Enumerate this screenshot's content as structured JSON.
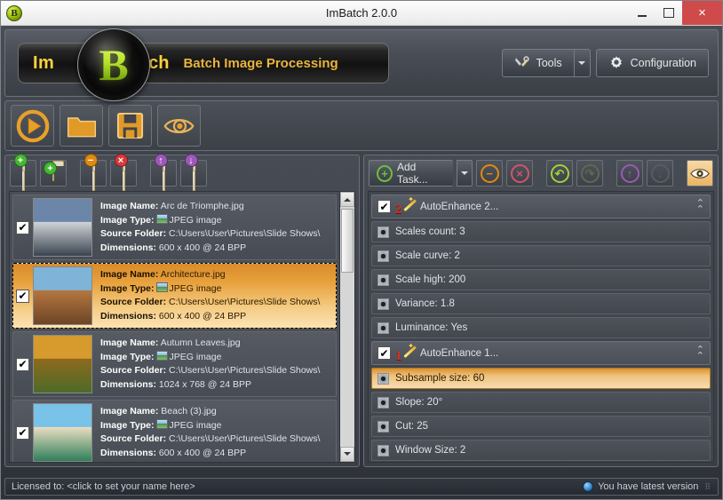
{
  "window": {
    "title": "ImBatch 2.0.0",
    "app_icon": "B",
    "minimize_label": "",
    "maximize_label": "",
    "close_label": "×"
  },
  "header": {
    "logo_part1": "Im",
    "logo_orb": "B",
    "logo_part2": "atch",
    "tagline": "Batch Image Processing",
    "tools_label": "Tools",
    "tools_dropdown_label": "",
    "configuration_label": "Configuration"
  },
  "main_toolbar": {
    "buttons": [
      {
        "name": "run-batch-button",
        "icon": "play-icon"
      },
      {
        "name": "open-folder-button",
        "icon": "folder-icon"
      },
      {
        "name": "save-button",
        "icon": "floppy-disk-icon"
      },
      {
        "name": "preview-button",
        "icon": "eye-icon"
      }
    ]
  },
  "images_panel": {
    "toolbar": [
      {
        "name": "add-images-button",
        "icon": "image-plus-icon",
        "badge": "+",
        "badge_color": "#44b832"
      },
      {
        "name": "add-folder-button",
        "icon": "folder-plus-icon",
        "badge": "+",
        "badge_color": "#44b832"
      },
      {
        "name": "remove-image-button",
        "icon": "image-minus-icon",
        "badge": "−",
        "badge_color": "#e08a14"
      },
      {
        "name": "clear-images-button",
        "icon": "image-delete-icon",
        "badge": "×",
        "badge_color": "#d63b3b"
      },
      {
        "name": "move-image-up-button",
        "icon": "image-up-icon",
        "badge": "↑",
        "badge_color": "#9b59b6"
      },
      {
        "name": "move-image-down-button",
        "icon": "image-down-icon",
        "badge": "↓",
        "badge_color": "#9b59b6"
      }
    ],
    "labels": {
      "image_name": "Image Name:",
      "image_type": "Image Type:",
      "source_folder": "Source Folder:",
      "dimensions": "Dimensions:"
    },
    "items": [
      {
        "checked": true,
        "selected": false,
        "name": "Arc de Triomphe.jpg",
        "type": "JPEG image",
        "folder": "C:\\Users\\User\\Pictures\\Slide Shows\\",
        "dimensions": "600 x 400 @ 24 BPP",
        "thumb_colors": [
          "#6b86a8",
          "#cfd3d6",
          "#3a4450"
        ]
      },
      {
        "checked": true,
        "selected": true,
        "name": "Architecture.jpg",
        "type": "JPEG image",
        "folder": "C:\\Users\\User\\Pictures\\Slide Shows\\",
        "dimensions": "600 x 400 @ 24 BPP",
        "thumb_colors": [
          "#7fb4d8",
          "#b5763f",
          "#6d4526"
        ]
      },
      {
        "checked": true,
        "selected": false,
        "name": "Autumn Leaves.jpg",
        "type": "JPEG image",
        "folder": "C:\\Users\\User\\Pictures\\Slide Shows\\",
        "dimensions": "1024 x 768 @ 24 BPP",
        "thumb_colors": [
          "#d79a2c",
          "#8c6a1e",
          "#4d6b28"
        ]
      },
      {
        "checked": true,
        "selected": false,
        "name": "Beach (3).jpg",
        "type": "JPEG image",
        "folder": "C:\\Users\\User\\Pictures\\Slide Shows\\",
        "dimensions": "600 x 400 @ 24 BPP",
        "thumb_colors": [
          "#79c2e8",
          "#e8ddc0",
          "#2f7f5a"
        ]
      }
    ]
  },
  "tasks_panel": {
    "add_task_label": "Add Task...",
    "toolbar": [
      {
        "name": "remove-task-button",
        "icon": "minus-circle-icon",
        "glyph": "−",
        "color": "#e08a14"
      },
      {
        "name": "delete-task-button",
        "icon": "x-circle-icon",
        "glyph": "×",
        "color": "#d0556a"
      },
      {
        "name": "undo-button",
        "icon": "undo-arrow-icon",
        "glyph": "↶",
        "color": "#9fd13a"
      },
      {
        "name": "redo-button",
        "icon": "redo-arrow-icon",
        "glyph": "↷",
        "color": "#5d6a52"
      },
      {
        "name": "move-task-up-button",
        "icon": "arrow-up-circle-icon",
        "glyph": "↑",
        "color": "#9b59b6"
      },
      {
        "name": "move-task-down-button",
        "icon": "arrow-down-circle-icon",
        "glyph": "↓",
        "color": "#585c63"
      },
      {
        "name": "task-preview-button",
        "icon": "eye-icon",
        "glyph": "",
        "color": "#f0c070"
      }
    ],
    "groups": [
      {
        "checked": true,
        "title": "AutoEnhance 2...",
        "number": "2",
        "collapse_icon": "chevron-up-double-icon",
        "params": [
          {
            "label": "Scales count: 3",
            "selected": false
          },
          {
            "label": "Scale curve: 2",
            "selected": false
          },
          {
            "label": "Scale high: 200",
            "selected": false
          },
          {
            "label": "Variance: 1.8",
            "selected": false
          },
          {
            "label": "Luminance: Yes",
            "selected": false
          }
        ]
      },
      {
        "checked": true,
        "title": "AutoEnhance 1...",
        "number": "1",
        "collapse_icon": "chevron-up-double-icon",
        "params": [
          {
            "label": "Subsample size: 60",
            "selected": true
          },
          {
            "label": "Slope: 20°",
            "selected": false
          },
          {
            "label": "Cut: 25",
            "selected": false
          },
          {
            "label": "Window Size: 2",
            "selected": false
          }
        ]
      }
    ]
  },
  "statusbar": {
    "license_text": "Licensed to: <click to set your name here>",
    "version_text": "You have latest version"
  }
}
